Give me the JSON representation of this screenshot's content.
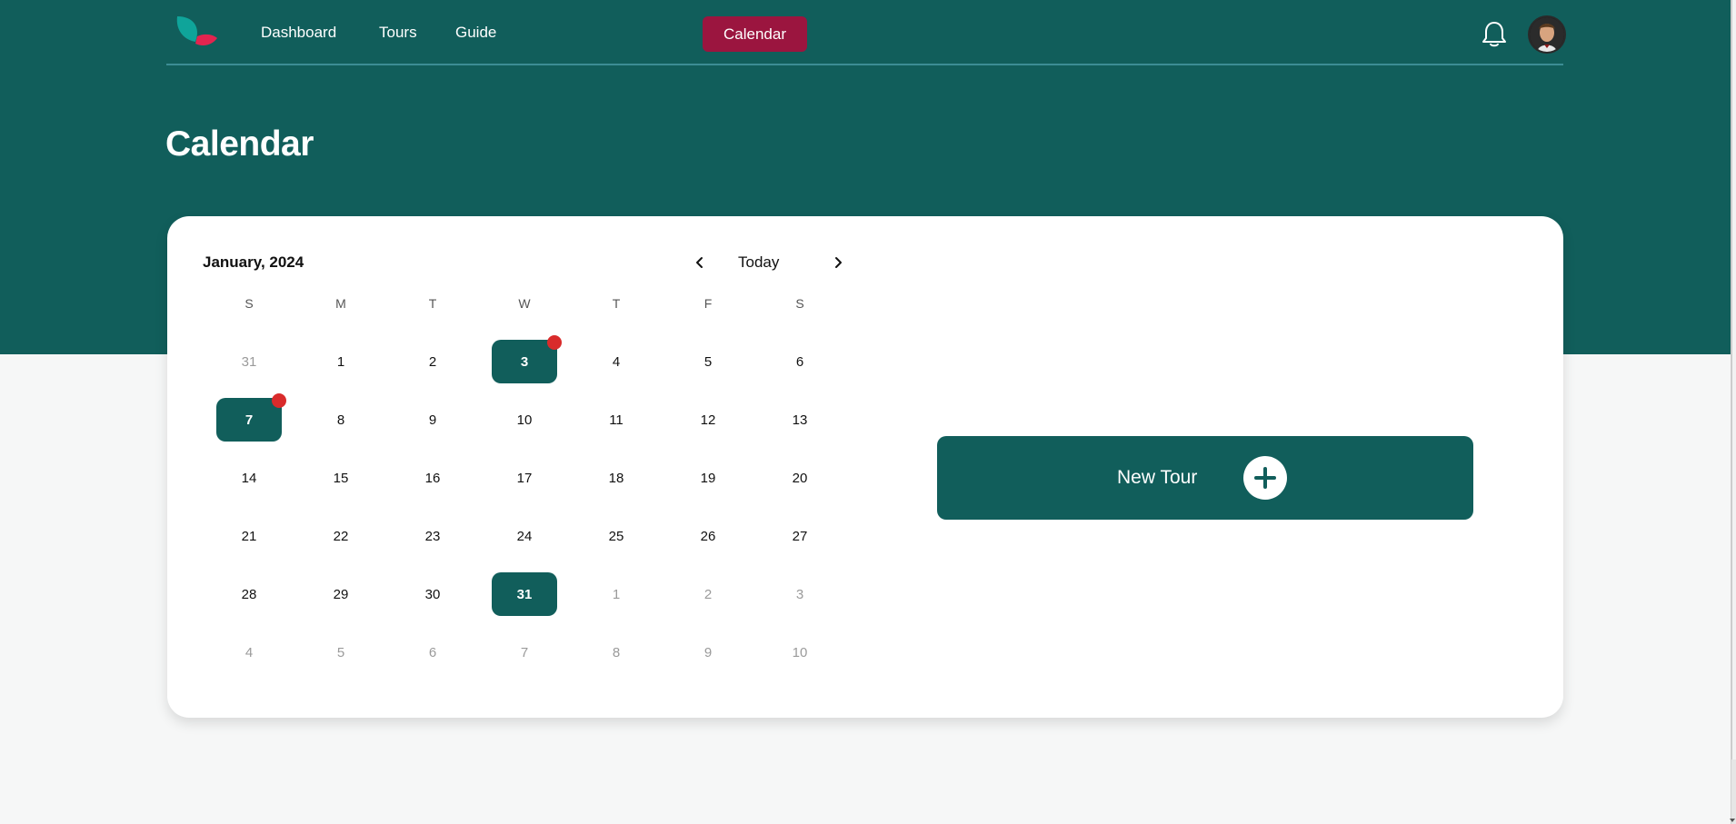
{
  "colors": {
    "primary": "#115e5b",
    "accent": "#9b153f",
    "badge": "#d92b2b",
    "background": "#f6f7f7"
  },
  "nav": {
    "logo_icon": "leaf-logo-icon",
    "links": [
      "Dashboard",
      "Tours",
      "Guide"
    ],
    "active": "Calendar",
    "bell_icon": "bell-icon",
    "avatar_icon": "user-avatar"
  },
  "page": {
    "title": "Calendar"
  },
  "calendar": {
    "month_label": "January, 2024",
    "today_label": "Today",
    "prev_icon": "chevron-left-icon",
    "next_icon": "chevron-right-icon",
    "weekdays": [
      "S",
      "M",
      "T",
      "W",
      "T",
      "F",
      "S"
    ],
    "weeks": [
      [
        {
          "d": "31",
          "m": true
        },
        {
          "d": "1"
        },
        {
          "d": "2"
        },
        {
          "d": "3",
          "sel": true,
          "dot": true
        },
        {
          "d": "4"
        },
        {
          "d": "5"
        },
        {
          "d": "6"
        }
      ],
      [
        {
          "d": "7",
          "sel": true,
          "dot": true
        },
        {
          "d": "8"
        },
        {
          "d": "9"
        },
        {
          "d": "10"
        },
        {
          "d": "11"
        },
        {
          "d": "12"
        },
        {
          "d": "13"
        }
      ],
      [
        {
          "d": "14"
        },
        {
          "d": "15"
        },
        {
          "d": "16"
        },
        {
          "d": "17"
        },
        {
          "d": "18"
        },
        {
          "d": "19"
        },
        {
          "d": "20"
        }
      ],
      [
        {
          "d": "21"
        },
        {
          "d": "22"
        },
        {
          "d": "23"
        },
        {
          "d": "24"
        },
        {
          "d": "25"
        },
        {
          "d": "26"
        },
        {
          "d": "27"
        }
      ],
      [
        {
          "d": "28"
        },
        {
          "d": "29"
        },
        {
          "d": "30"
        },
        {
          "d": "31",
          "sel": true
        },
        {
          "d": "1",
          "m": true
        },
        {
          "d": "2",
          "m": true
        },
        {
          "d": "3",
          "m": true
        }
      ],
      [
        {
          "d": "4",
          "m": true
        },
        {
          "d": "5",
          "m": true
        },
        {
          "d": "6",
          "m": true
        },
        {
          "d": "7",
          "m": true
        },
        {
          "d": "8",
          "m": true
        },
        {
          "d": "9",
          "m": true
        },
        {
          "d": "10",
          "m": true
        }
      ]
    ]
  },
  "actions": {
    "new_tour_label": "New Tour",
    "new_tour_icon": "plus-circle-icon"
  }
}
